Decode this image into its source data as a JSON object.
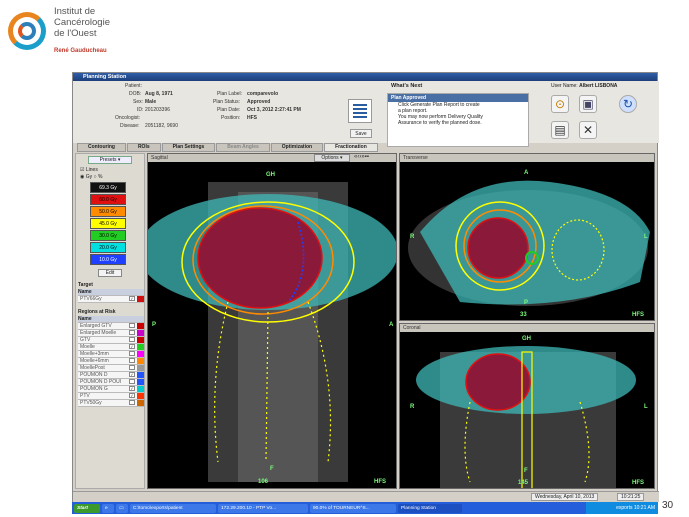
{
  "logo": {
    "line1": "Institut de",
    "line2": "Cancérologie",
    "line3": "de l'Ouest",
    "sub": "René Gauducheau"
  },
  "slide_number": "30",
  "window": {
    "title": "Planning Station"
  },
  "patient": {
    "patient_label": "Patient:",
    "patient_value": "",
    "dob_label": "DOB:",
    "dob_value": "Aug 8, 1971",
    "sex_label": "Sex:",
    "sex_value": "Male",
    "id_label": "ID:",
    "id_value": "201203396",
    "oncologist_label": "Oncologist:",
    "oncologist_value": "",
    "disease_label": "Disease:",
    "disease_value": "2051182, 9690"
  },
  "plan": {
    "label_label": "Plan Label:",
    "label_value": "comparevolo",
    "status_label": "Plan Status:",
    "status_value": "Approved",
    "date_label": "Plan Date:",
    "date_value": "Oct 3, 2012 2:27:41 PM",
    "position_label": "Position:",
    "position_value": "HFS"
  },
  "save_label": "Save",
  "whats_next": {
    "title": "What's Next",
    "header": "Plan Approved",
    "bullet1": "Click Generate Plan Report to create",
    "bullet1b": "a plan report.",
    "bullet2": "You may now perform Delivery Quality",
    "bullet2b": "Assurance to verify the planned dose."
  },
  "user": {
    "label": "User Name:",
    "value": "Albert LISBONA"
  },
  "tabs": [
    "Contouring",
    "ROIs",
    "Plan Settings",
    "Beam Angles",
    "Optimization",
    "Fractionation"
  ],
  "left_panel": {
    "presets": "Presets ▾",
    "lines": "Lines",
    "gy": "Gy",
    "pct": "%",
    "isodoses": [
      {
        "label": "69.3 Gy",
        "color": "#111111",
        "text": "#ffffff"
      },
      {
        "label": "60.0 Gy",
        "color": "#e01010",
        "text": "#000000"
      },
      {
        "label": "50.0 Gy",
        "color": "#ff8c00",
        "text": "#000000"
      },
      {
        "label": "45.0 Gy",
        "color": "#ffff00",
        "text": "#000000"
      },
      {
        "label": "30.0 Gy",
        "color": "#22cc22",
        "text": "#000000"
      },
      {
        "label": "20.0 Gy",
        "color": "#00e0e0",
        "text": "#000000"
      },
      {
        "label": "10.0 Gy",
        "color": "#2040ff",
        "text": "#ffffff"
      }
    ],
    "edit": "Edit",
    "target_title": "Target",
    "name_header": "Name",
    "targets": [
      {
        "name": "PTV66Gy",
        "color": "#d01010",
        "checked": "✓"
      }
    ],
    "rar_title": "Regions at Risk",
    "regions": [
      {
        "name": "Enlarged GTV",
        "color": "#cc0000",
        "checked": ""
      },
      {
        "name": "Enlarged Moelle",
        "color": "#cc00cc",
        "checked": ""
      },
      {
        "name": "GTV",
        "color": "#cc0000",
        "checked": ""
      },
      {
        "name": "Moelle",
        "color": "#22cc22",
        "checked": "✓"
      },
      {
        "name": "Moelle+3mm",
        "color": "#ff00ff",
        "checked": ""
      },
      {
        "name": "Moelle+6mm",
        "color": "#ff8800",
        "checked": ""
      },
      {
        "name": "MoellePost",
        "color": "#999999",
        "checked": ""
      },
      {
        "name": "POUMON D",
        "color": "#2255ff",
        "checked": "✓"
      },
      {
        "name": "POUMON D POUI",
        "color": "#2255ff",
        "checked": ""
      },
      {
        "name": "POUMON G",
        "color": "#00cccc",
        "checked": "✓"
      },
      {
        "name": "PTV",
        "color": "#ff3300",
        "checked": "✓"
      },
      {
        "name": "PTV50Gy",
        "color": "#cc6600",
        "checked": ""
      }
    ]
  },
  "views": {
    "sagittal": {
      "title": "Sagittal",
      "options": "Options ▾",
      "top": "GH",
      "bottom": "F",
      "left": "P",
      "right": "A",
      "slice": "106",
      "orient": "HFS"
    },
    "transverse": {
      "title": "Transverse",
      "top": "A",
      "bottom": "P",
      "left": "R",
      "right": "L",
      "slice": "33",
      "orient": "HFS"
    },
    "coronal": {
      "title": "Coronal",
      "top": "GH",
      "bottom": "F",
      "left": "R",
      "right": "L",
      "slice": "145",
      "orient": "HFS"
    }
  },
  "status": {
    "date": "Wednesday, April 10, 2013",
    "time": "10:21:25"
  },
  "taskbar": {
    "start": "Start",
    "items": [
      "C:\\tomo\\exports\\patient",
      "172.29.200.10 - PTP Vo...",
      "90.0% of TOURNEUR^S...",
      "Planning Station"
    ],
    "tray_left": "exports",
    "clock": "10:21 AM"
  },
  "colors": {
    "titlebar": "#2f5ea8",
    "lung": "#3fb8b8",
    "ptv": "#8b1a3a"
  }
}
